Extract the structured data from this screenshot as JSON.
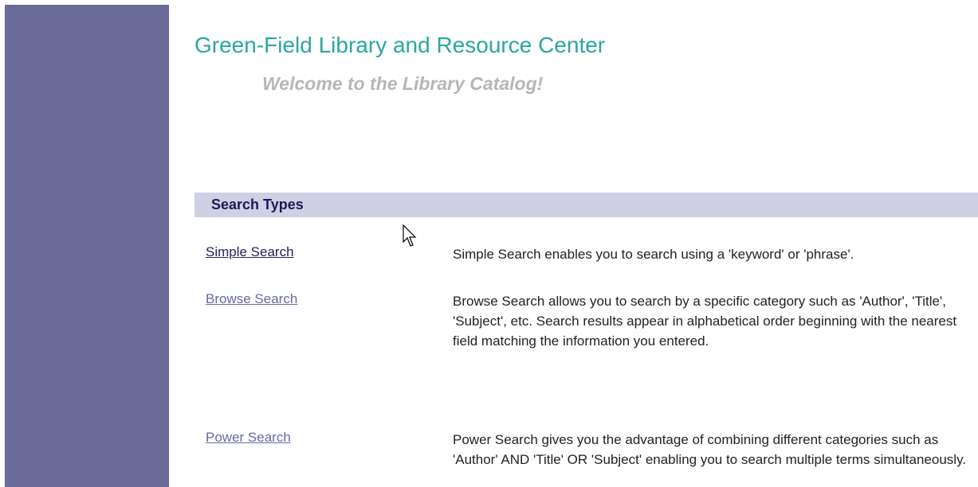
{
  "header": {
    "title": "Green-Field Library and Resource Center",
    "welcome": "Welcome to the Library Catalog!"
  },
  "section": {
    "title": "Search Types"
  },
  "search_types": [
    {
      "label": "Simple Search",
      "description": "Simple Search enables you to search using a 'keyword' or 'phrase'."
    },
    {
      "label": "Browse Search",
      "description": "Browse Search allows you to search by a specific category such as 'Author', 'Title', 'Subject', etc. Search results appear in alphabetical order beginning with the nearest field matching the information you entered."
    },
    {
      "label": "Power Search",
      "description": "Power Search gives you the advantage of combining different categories such as 'Author' AND 'Title' OR 'Subject' enabling you to search multiple terms simultaneously."
    }
  ],
  "colors": {
    "sidebar": "#6b6b9a",
    "title": "#2aa7a0",
    "welcome": "#b6b6b6",
    "section_bar": "#d0d0e4",
    "visited_link": "#21215a",
    "link": "#6868a6"
  },
  "icons": {
    "cursor": "mouse-pointer-icon"
  }
}
